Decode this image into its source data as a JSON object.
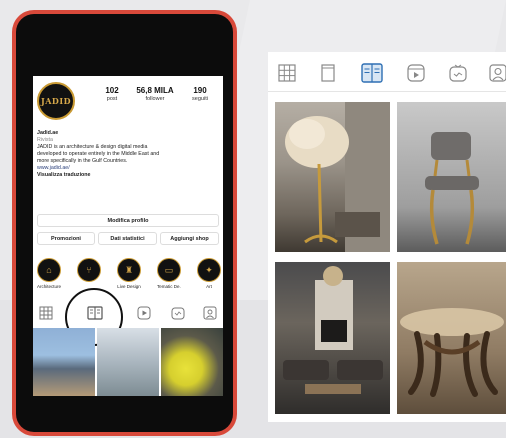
{
  "profile": {
    "username_logo": "JADID",
    "stats": [
      {
        "value": "102",
        "label": "post"
      },
      {
        "value": "56,8 MILA",
        "label": "follower"
      },
      {
        "value": "190",
        "label": "seguiti"
      }
    ],
    "name": "Jadid.ae",
    "category": "Rivista",
    "bio_lines": [
      "JADID is an architecture & design digital media",
      "developed to operate entirely in the Middle East and",
      "more specifically in the Gulf Countries."
    ],
    "link": "www.jadid.ae/",
    "translate_label": "Visualizza traduzione"
  },
  "buttons": {
    "edit_profile": "Modifica profilo",
    "promotions": "Promozioni",
    "insights": "Dati statistici",
    "add_shop": "Aggiungi shop"
  },
  "highlights": [
    {
      "label": "Architecture",
      "icon": "building-icon"
    },
    {
      "label": "",
      "icon": "chair-icon"
    },
    {
      "label": "Live Design",
      "icon": "lamp-icon"
    },
    {
      "label": "Tematic De...",
      "icon": "sofa-icon"
    },
    {
      "label": "Art",
      "icon": "art-icon"
    }
  ],
  "colors": {
    "phone_frame": "#d8493a",
    "gold": "#c99a33",
    "link": "#2a3f7a"
  },
  "tabs": [
    "grid-icon",
    "reels-frame-icon",
    "guide-icon",
    "play-icon",
    "igtv-icon",
    "tagged-icon"
  ]
}
